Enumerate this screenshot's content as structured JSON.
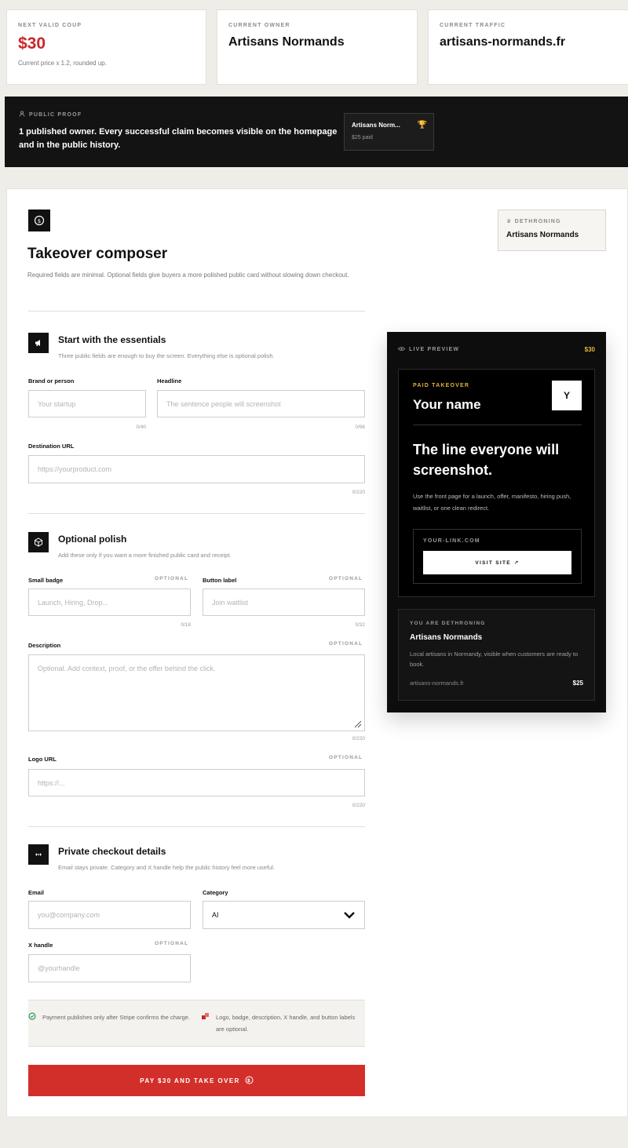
{
  "stats": [
    {
      "label": "NEXT VALID COUP",
      "value": "$30",
      "sub": "Current price x 1.2, rounded up."
    },
    {
      "label": "CURRENT OWNER",
      "value": "Artisans Normands"
    },
    {
      "label": "CURRENT TRAFFIC",
      "value": "artisans-normands.fr"
    }
  ],
  "proof": {
    "label": "PUBLIC PROOF",
    "message": "1 published owner. Every successful claim becomes visible on the homepage and in the public history.",
    "chip_title": "Artisans Norm...",
    "chip_sub": "$25 paid"
  },
  "composer": {
    "title": "Takeover composer",
    "intro": "Required fields are minimal. Optional fields give buyers a more polished public card without slowing down checkout.",
    "dethroning_label": "DETHRONING",
    "dethroning_value": "Artisans Normands"
  },
  "essentials": {
    "title": "Start with the essentials",
    "sub": "Three public fields are enough to buy the screen. Everything else is optional polish.",
    "brand_label": "Brand or person",
    "brand_placeholder": "Your startup",
    "brand_count": "0/40",
    "headline_label": "Headline",
    "headline_placeholder": "The sentence people will screenshot",
    "headline_count": "0/96",
    "url_label": "Destination URL",
    "url_placeholder": "https://yourproduct.com",
    "url_count": "0/220"
  },
  "optional": {
    "title": "Optional polish",
    "sub": "Add these only if you want a more finished public card and receipt.",
    "optional_tag": "OPTIONAL",
    "badge_label": "Small badge",
    "badge_placeholder": "Launch, Hiring, Drop...",
    "badge_count": "0/18",
    "button_label": "Button label",
    "button_placeholder": "Join waitlist",
    "button_count": "0/32",
    "desc_label": "Description",
    "desc_placeholder": "Optional. Add context, proof, or the offer behind the click.",
    "desc_count": "0/220",
    "logo_label": "Logo URL",
    "logo_placeholder": "https://...",
    "logo_count": "0/220"
  },
  "checkout": {
    "title": "Private checkout details",
    "sub": "Email stays private. Category and X handle help the public history feel more useful.",
    "email_label": "Email",
    "email_placeholder": "you@company.com",
    "category_label": "Category",
    "category_value": "AI",
    "x_label": "X handle",
    "x_placeholder": "@yourhandle"
  },
  "notes": {
    "left": "Payment publishes only after Stripe confirms the charge.",
    "right": "Logo, badge, description, X handle, and button labels are optional."
  },
  "pay_button": "PAY $30 AND TAKE OVER",
  "preview": {
    "label": "LIVE PREVIEW",
    "price": "$30",
    "paid_tag": "PAID TAKEOVER",
    "name": "Your name",
    "logo_letter": "Y",
    "headline": "The line everyone will screenshot.",
    "description": "Use the front page for a launch, offer, manifesto, hiring push, waitlist, or one clean redirect.",
    "domain": "YOUR-LINK.COM",
    "visit_label": "VISIT SITE",
    "dethroning_label": "YOU ARE DETHRONING",
    "dethroning_name": "Artisans Normands",
    "dethroning_desc": "Local artisans in Normandy, visible when customers are ready to book.",
    "dethroning_url": "artisans-normands.fr",
    "dethroning_price": "$25"
  },
  "colors": {
    "accent_red": "#d32f2a",
    "gold": "#e4b53a",
    "dark": "#131313"
  }
}
